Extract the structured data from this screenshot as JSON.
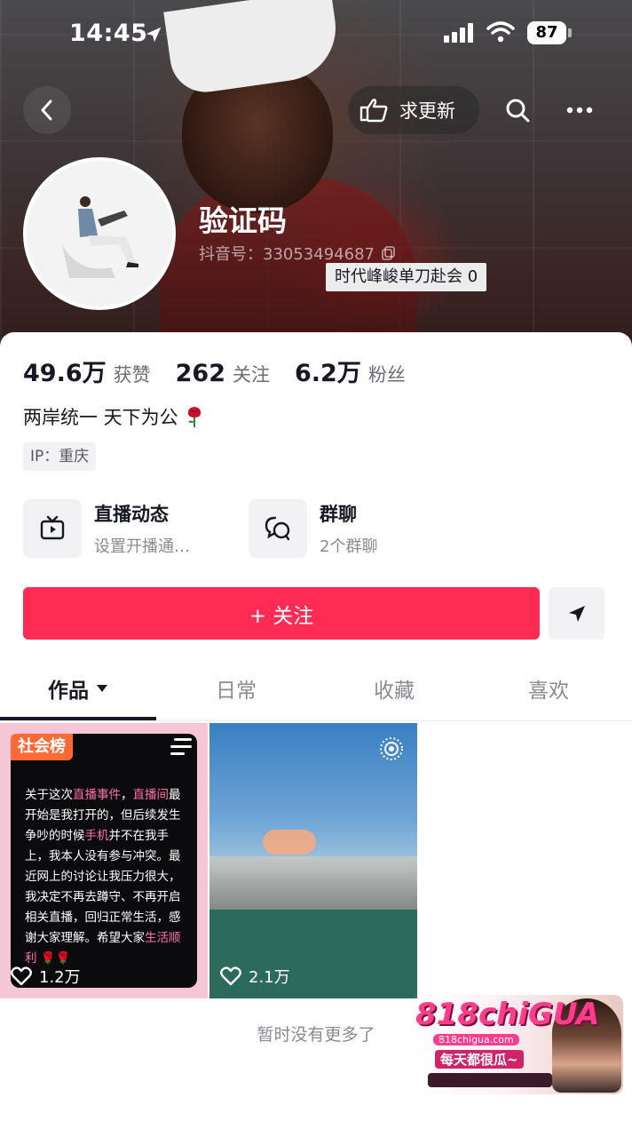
{
  "status_bar": {
    "time": "14:45",
    "battery": "87"
  },
  "header": {
    "update_label": "求更新",
    "username": "验证码",
    "douyin_id": "抖音号：33053494687",
    "tooltip": "时代峰峻单刀赴会 0"
  },
  "stats": [
    {
      "value": "49.6万",
      "label": "获赞"
    },
    {
      "value": "262",
      "label": "关注"
    },
    {
      "value": "6.2万",
      "label": "粉丝"
    }
  ],
  "bio": "两岸统一 天下为公",
  "ip": "IP：重庆",
  "entries": [
    {
      "title": "直播动态",
      "subtitle": "设置开播通…",
      "icon": "tv-icon"
    },
    {
      "title": "群聊",
      "subtitle": "2个群聊",
      "icon": "chat-bubbles-icon"
    }
  ],
  "follow_label": "+ 关注",
  "tabs": [
    {
      "label": "作品",
      "active": true
    },
    {
      "label": "日常",
      "active": false
    },
    {
      "label": "收藏",
      "active": false
    },
    {
      "label": "喜欢",
      "active": false
    }
  ],
  "posts": [
    {
      "badge": "社会榜",
      "likes": "1.2万",
      "text_parts": [
        {
          "t": "关于这次",
          "hl": false
        },
        {
          "t": "直播事件",
          "hl": true
        },
        {
          "t": "，",
          "hl": false
        },
        {
          "t": "直播间",
          "hl": true
        },
        {
          "t": "最开始是我打开的，但后续发生争吵的时候",
          "hl": false
        },
        {
          "t": "手机",
          "hl": true
        },
        {
          "t": "并不在我手上，我本人没有参与冲突。最近网上的讨论让我压力很大，我决定不再去蹲守、不再开启相关直播，回归正常生活，感谢大家理解。希望大家",
          "hl": false
        },
        {
          "t": "生活顺利",
          "hl": true
        },
        {
          "t": " 🌹🌹",
          "hl": false
        }
      ]
    },
    {
      "likes": "2.1万"
    }
  ],
  "footer_note": "暂时没有更多了",
  "watermark": {
    "logo": "818chiGUA",
    "url": "818chigua.com",
    "slogan": "每天都很瓜~"
  },
  "colors": {
    "accent": "#fe2c55",
    "badge": "#fe6a35"
  }
}
